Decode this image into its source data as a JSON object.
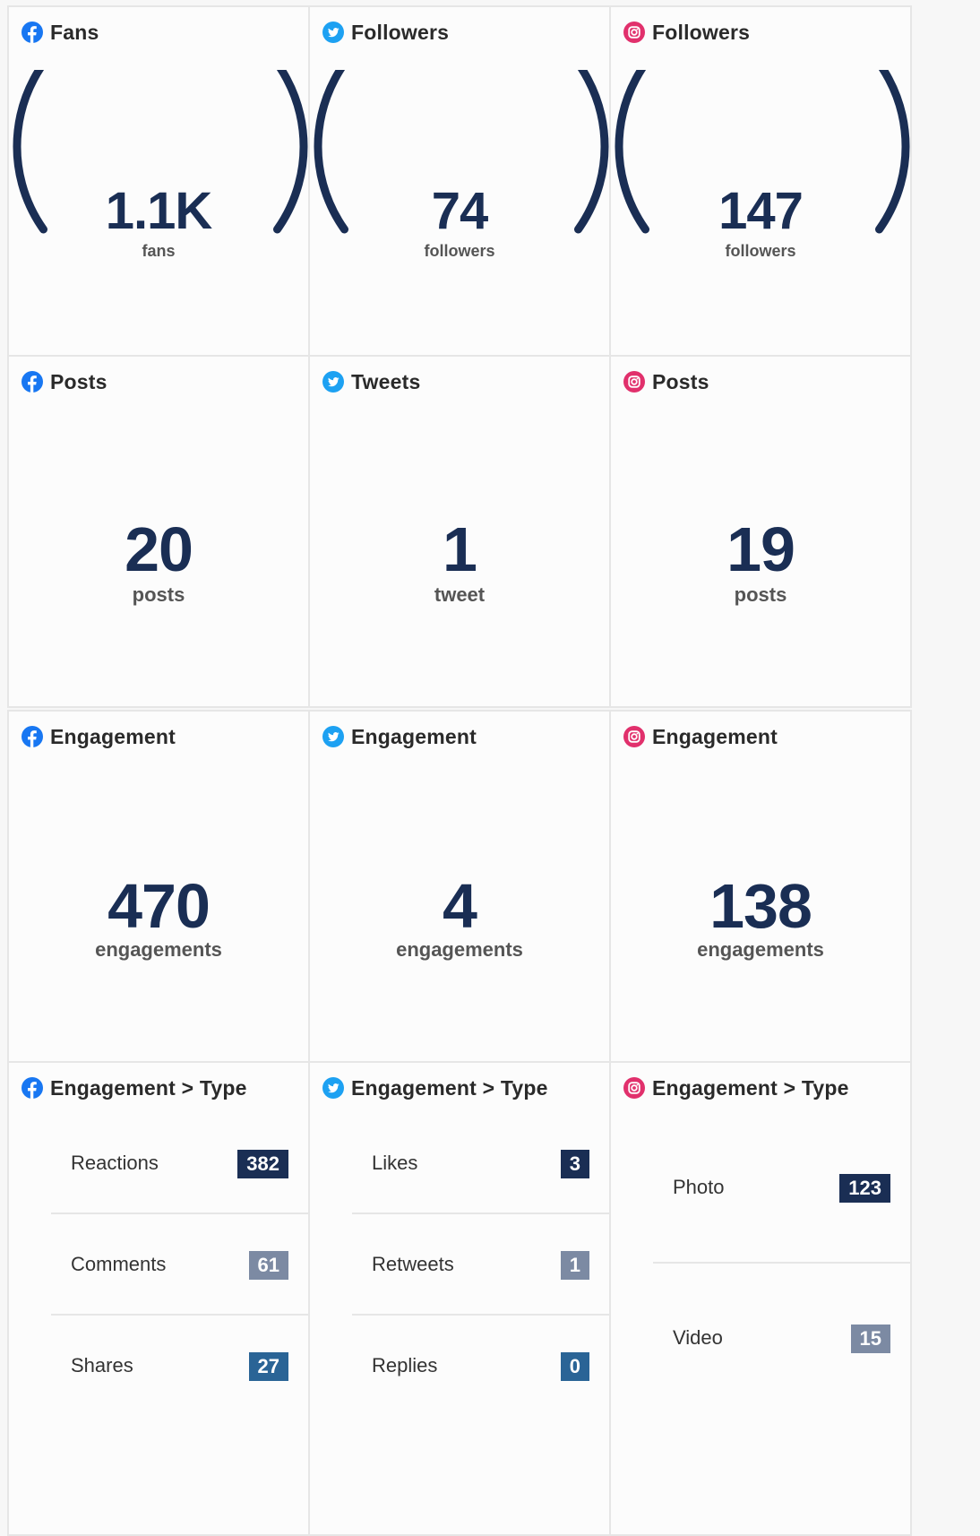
{
  "colors": {
    "facebook": "#1877f2",
    "twitter": "#1da1f2",
    "instagram": "#e1306c",
    "navy": "#1a2e54",
    "badge_navy": "#1a2e54",
    "badge_gray": "#7c8aa3",
    "badge_blue": "#2a6496"
  },
  "row1": {
    "facebook": {
      "icon": "facebook-icon",
      "title": "Fans",
      "value": "1.1K",
      "unit": "fans"
    },
    "twitter": {
      "icon": "twitter-icon",
      "title": "Followers",
      "value": "74",
      "unit": "followers"
    },
    "instagram": {
      "icon": "instagram-icon",
      "title": "Followers",
      "value": "147",
      "unit": "followers"
    }
  },
  "row2": {
    "facebook": {
      "icon": "facebook-icon",
      "title": "Posts",
      "value": "20",
      "unit": "posts"
    },
    "twitter": {
      "icon": "twitter-icon",
      "title": "Tweets",
      "value": "1",
      "unit": "tweet"
    },
    "instagram": {
      "icon": "instagram-icon",
      "title": "Posts",
      "value": "19",
      "unit": "posts"
    }
  },
  "row3": {
    "facebook": {
      "icon": "facebook-icon",
      "title": "Engagement",
      "value": "470",
      "unit": "engagements"
    },
    "twitter": {
      "icon": "twitter-icon",
      "title": "Engagement",
      "value": "4",
      "unit": "engagements"
    },
    "instagram": {
      "icon": "instagram-icon",
      "title": "Engagement",
      "value": "138",
      "unit": "engagements"
    }
  },
  "row4": {
    "facebook": {
      "icon": "facebook-icon",
      "title": "Engagement > Type",
      "items": [
        {
          "label": "Reactions",
          "value": "382",
          "badge": "navy"
        },
        {
          "label": "Comments",
          "value": "61",
          "badge": "gray"
        },
        {
          "label": "Shares",
          "value": "27",
          "badge": "blue"
        }
      ]
    },
    "twitter": {
      "icon": "twitter-icon",
      "title": "Engagement > Type",
      "items": [
        {
          "label": "Likes",
          "value": "3",
          "badge": "navy"
        },
        {
          "label": "Retweets",
          "value": "1",
          "badge": "gray"
        },
        {
          "label": "Replies",
          "value": "0",
          "badge": "blue"
        }
      ]
    },
    "instagram": {
      "icon": "instagram-icon",
      "title": "Engagement > Type",
      "items": [
        {
          "label": "Photo",
          "value": "123",
          "badge": "navy"
        },
        {
          "label": "Video",
          "value": "15",
          "badge": "gray"
        }
      ]
    }
  }
}
